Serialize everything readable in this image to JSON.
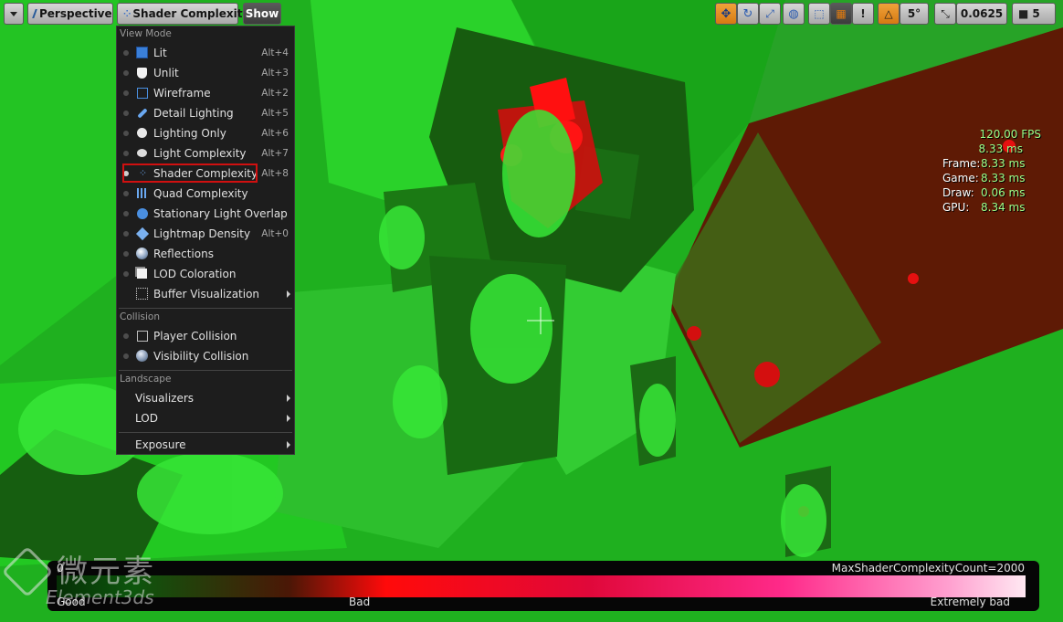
{
  "toolbar": {
    "perspective_label": "Perspective",
    "viewmode_label": "Shader Complexity",
    "show_label": "Show",
    "rotation_snap_value": "5°",
    "scale_snap_value": "0.0625",
    "camera_speed_value": "5"
  },
  "menu": {
    "view_mode_header": "View Mode",
    "view_mode_items": [
      {
        "label": "Lit",
        "shortcut": "Alt+4",
        "icon": "cube-icon"
      },
      {
        "label": "Unlit",
        "shortcut": "Alt+3",
        "icon": "shield-icon"
      },
      {
        "label": "Wireframe",
        "shortcut": "Alt+2",
        "icon": "wireframe-cube-icon"
      },
      {
        "label": "Detail Lighting",
        "shortcut": "Alt+5",
        "icon": "flashlight-icon"
      },
      {
        "label": "Lighting Only",
        "shortcut": "Alt+6",
        "icon": "lighting-only-icon"
      },
      {
        "label": "Light Complexity",
        "shortcut": "Alt+7",
        "icon": "light-complexity-icon"
      },
      {
        "label": "Shader Complexity",
        "shortcut": "Alt+8",
        "icon": "shader-complexity-icon"
      },
      {
        "label": "Quad Complexity",
        "shortcut": "",
        "icon": "quad-grid-icon"
      },
      {
        "label": "Stationary Light Overlap",
        "shortcut": "",
        "icon": "sphere-icon"
      },
      {
        "label": "Lightmap Density",
        "shortcut": "Alt+0",
        "icon": "layers-icon"
      },
      {
        "label": "Reflections",
        "shortcut": "",
        "icon": "reflection-sphere-icon"
      },
      {
        "label": "LOD Coloration",
        "shortcut": "",
        "icon": "lod-icon"
      },
      {
        "label": "Buffer Visualization",
        "shortcut": "",
        "icon": "buffer-grid-icon"
      }
    ],
    "collision_header": "Collision",
    "collision_items": [
      {
        "label": "Player Collision",
        "icon": "wire-cube-icon"
      },
      {
        "label": "Visibility Collision",
        "icon": "sphere-icon"
      }
    ],
    "landscape_header": "Landscape",
    "landscape_items": [
      {
        "label": "Visualizers"
      },
      {
        "label": "LOD"
      }
    ],
    "exposure_label": "Exposure"
  },
  "stats": {
    "fps": "120.00 FPS",
    "ms": "8.33 ms",
    "frame_label": "Frame:",
    "frame_value": "8.33 ms",
    "game_label": "Game:",
    "game_value": "8.33 ms",
    "draw_label": "Draw:",
    "draw_value": "0.06 ms",
    "gpu_label": "GPU:",
    "gpu_value": "8.34 ms"
  },
  "legend": {
    "min_label": "0",
    "max_label": "MaxShaderComplexityCount=2000",
    "good_label": "Good",
    "bad_label": "Bad",
    "extremely_bad_label": "Extremely bad"
  },
  "watermark": {
    "cn_text": "微元素",
    "en_text": "Element3ds"
  }
}
